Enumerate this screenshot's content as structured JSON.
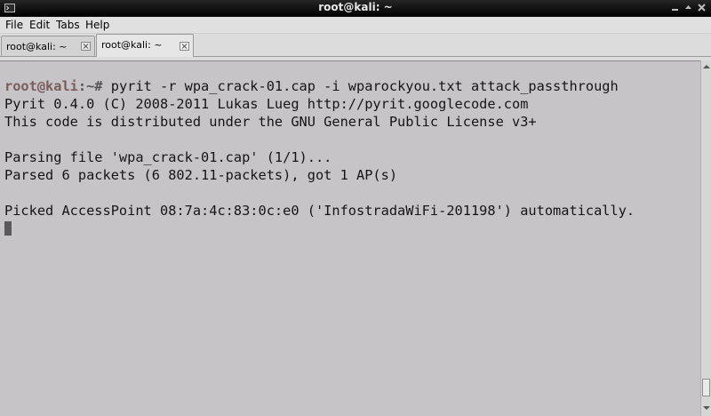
{
  "window": {
    "title": "root@kali: ~",
    "icon": "terminal-icon",
    "controls": [
      "minimize-icon",
      "maximize-icon",
      "close-icon"
    ]
  },
  "menu": {
    "file": "File",
    "edit": "Edit",
    "tabs": "Tabs",
    "help": "Help"
  },
  "tabs": [
    {
      "label": "root@kali: ~",
      "active": false
    },
    {
      "label": "root@kali: ~",
      "active": true
    }
  ],
  "terminal": {
    "prompt_user": "root@kali",
    "prompt_path": ":~# ",
    "command": "pyrit -r wpa_crack-01.cap -i wparockyou.txt attack_passthrough",
    "output": [
      "Pyrit 0.4.0 (C) 2008-2011 Lukas Lueg http://pyrit.googlecode.com",
      "This code is distributed under the GNU General Public License v3+",
      "",
      "Parsing file 'wpa_crack-01.cap' (1/1)...",
      "Parsed 6 packets (6 802.11-packets), got 1 AP(s)",
      "",
      "Picked AccessPoint 08:7a:4c:83:0c:e0 ('InfostradaWiFi-201198') automatically."
    ]
  },
  "colors": {
    "terminal_bg": "#c7c4c8",
    "terminal_fg": "#151515",
    "prompt_user": "#7a5c5c",
    "titlebar_bg": "#000000"
  }
}
